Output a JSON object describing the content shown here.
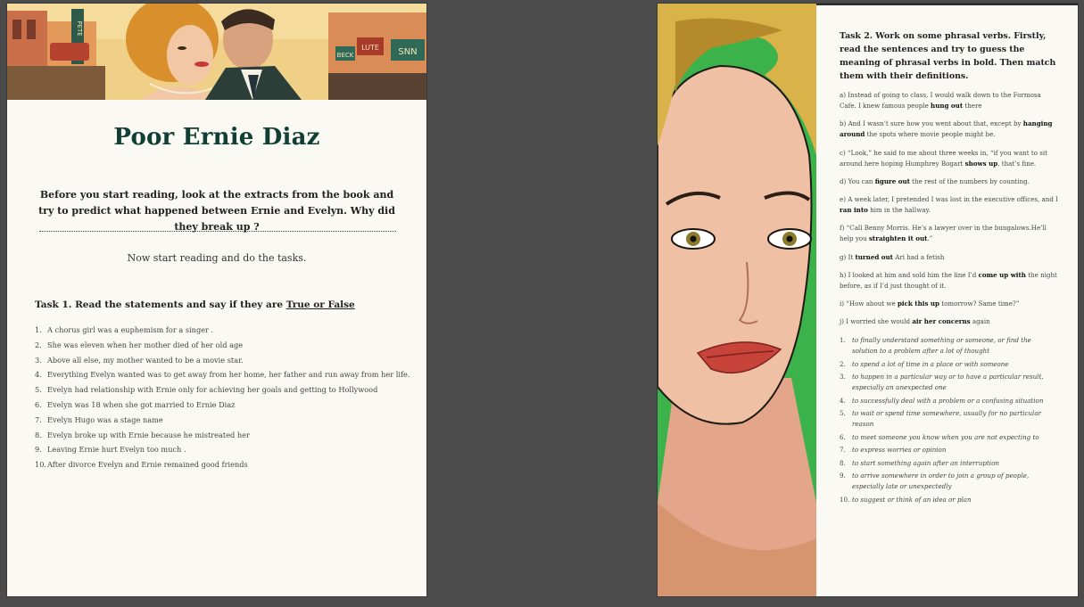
{
  "page1": {
    "title": "Poor Ernie Diaz",
    "intro": "Before you start reading, look at the extracts from the book and try to predict what happened between Ernie and Evelyn. Why did they break up ?",
    "now": "Now start reading and do the tasks.",
    "task1": {
      "heading": "Task 1. Read the statements and say if they are ",
      "heading_underlined": "True or False",
      "items": [
        {
          "n": "1.",
          "text": "A chorus girl was a euphemism for a singer ."
        },
        {
          "n": "2.",
          "text": "She was eleven when her mother died of her old age"
        },
        {
          "n": "3.",
          "text": "Above all else, my mother wanted to be a movie star."
        },
        {
          "n": "4.",
          "text": "Everything Evelyn wanted was to get away from her home, her father and run away from her life."
        },
        {
          "n": "5.",
          "text": "Evelyn had relationship with Ernie only for achieving her goals and getting to Hollywood"
        },
        {
          "n": "6.",
          "text": "Evelyn was 18 when she got married to Ernie Diaz"
        },
        {
          "n": "7.",
          "text": "Evelyn Hugo was a stage name"
        },
        {
          "n": "8.",
          "text": "Evelyn broke up with Ernie because he mistreated her"
        },
        {
          "n": "9.",
          "text": "Leaving Ernie hurt Evelyn too much ."
        },
        {
          "n": "10.",
          "text": "After divorce Evelyn and Ernie remained good friends"
        }
      ]
    },
    "banner_signs": [
      "PETE",
      "BECK",
      "LUTE",
      "SNN"
    ]
  },
  "page2": {
    "task2": "Task 2. Work on some phrasal verbs. Firstly, read the sentences and try to guess the meaning of phrasal verbs in bold. Then match them with their definitions.",
    "sentences": [
      {
        "pre": "a) Instead of going to class, I would walk down to the Formosa Cafe. I knew famous people ",
        "bold": "hung out",
        "post": " there"
      },
      {
        "pre": "b) And I wasn’t sure how you went about that, except by ",
        "bold": "hanging around",
        "post": " the spots where movie people might be."
      },
      {
        "pre": "c) “Look,” he said to me about three weeks in, “if you want to sit around here hoping Humphrey Bogart ",
        "bold": "shows up",
        "post": ", that’s fine."
      },
      {
        "pre": "d) You can ",
        "bold": "figure out",
        "post": " the rest of the numbers by counting."
      },
      {
        "pre": "e) A week later, I pretended I was lost in the executive offices, and I ",
        "bold": "ran into",
        "post": " him in the hallway."
      },
      {
        "pre": "f) “Call Benny Morris. He’s a lawyer over in the bungalows.He’ll help you ",
        "bold": "straighten it out",
        "post": ".”"
      },
      {
        "pre": "g) It ",
        "bold": "turned out",
        "post": " Ari had a fetish"
      },
      {
        "pre": "h) I looked at him and sold him the line I’d ",
        "bold": "come up with",
        "post": " the night before, as if I’d just thought of it."
      },
      {
        "pre": "i) “How about we ",
        "bold": "pick this up",
        "post": " tomorrow? Same time?”"
      },
      {
        "pre": "j) I worried she would ",
        "bold": "air her concerns",
        "post": " again"
      }
    ],
    "definitions": [
      {
        "n": "1.",
        "text": "to finally understand something or someone, or find the solution to a problem after a lot of thought"
      },
      {
        "n": "2.",
        "text": "to spend a lot of time in a place or with someone"
      },
      {
        "n": "3.",
        "text": "to happen in a particular way or to have a particular result, especially an unexpected one"
      },
      {
        "n": "4.",
        "text": "to successfully deal with a problem or a confusing situation"
      },
      {
        "n": "5.",
        "text": "to wait or spend time somewhere, usually for no particular reason"
      },
      {
        "n": "6.",
        "text": "to meet someone you know when you are not expecting to"
      },
      {
        "n": "7.",
        "text": "to express worries or opinion"
      },
      {
        "n": "8.",
        "text": "to start something again after an interruption"
      },
      {
        "n": "9.",
        "text": "to arrive somewhere in order to join a group of people, especially late or unexpectedly"
      },
      {
        "n": "10.",
        "text": "to suggest or think of an idea or plan"
      }
    ]
  },
  "colors": {
    "title": "#123f35",
    "background": "#4b4b4b",
    "paper": "#fbf9f4"
  }
}
